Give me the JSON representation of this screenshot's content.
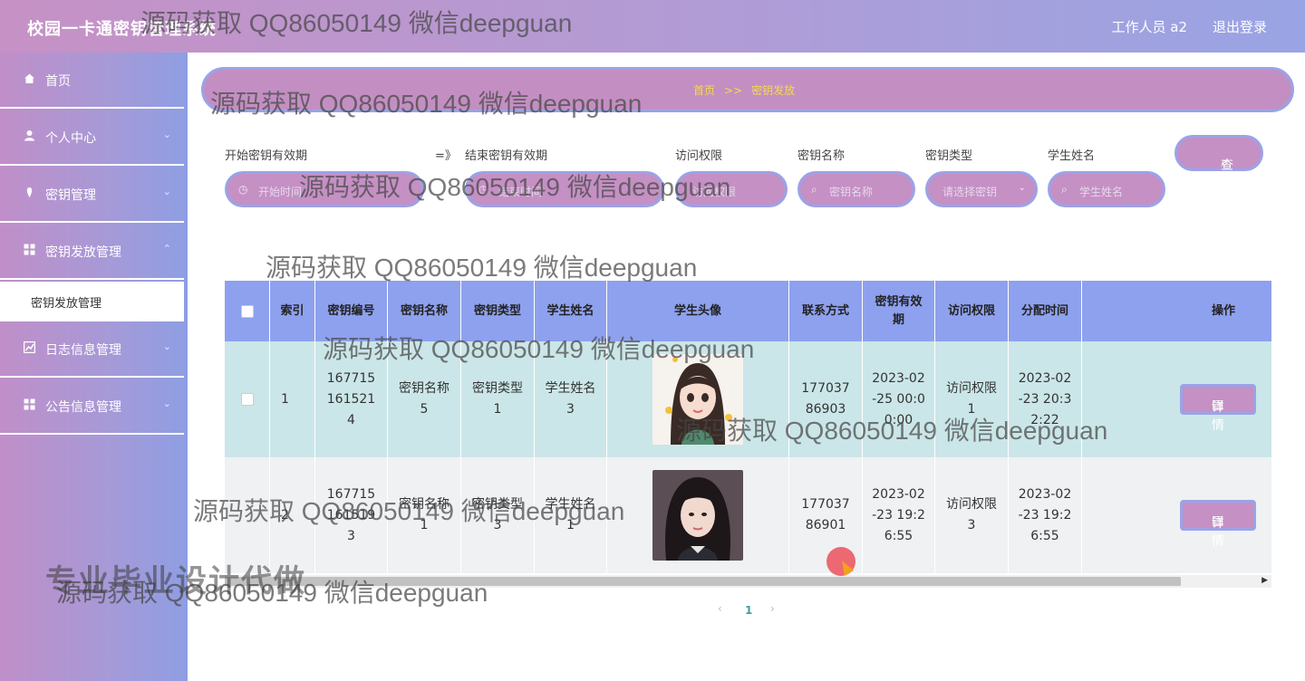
{
  "header": {
    "title": "校园一卡通密钥管理系统",
    "user": "工作人员 a2",
    "logout": "退出登录"
  },
  "sidebar": {
    "items": [
      {
        "label": "首页",
        "icon": "home-icon"
      },
      {
        "label": "个人中心",
        "icon": "user-icon"
      },
      {
        "label": "密钥管理",
        "icon": "key-icon"
      },
      {
        "label": "密钥发放管理",
        "icon": "grid-icon"
      },
      {
        "label": "日志信息管理",
        "icon": "chart-icon"
      },
      {
        "label": "公告信息管理",
        "icon": "grid-icon"
      }
    ],
    "active_sub": "密钥发放管理"
  },
  "breadcrumb": {
    "home": "首页",
    "sep": ">>",
    "current": "密钥发放"
  },
  "search": {
    "start_label": "开始密钥有效期",
    "start_placeholder": "开始时间",
    "arrow": "=》",
    "end_label": "结束密钥有效期",
    "end_placeholder": "结束时间",
    "perm_label": "访问权限",
    "perm_placeholder": "访问权限",
    "keyname_label": "密钥名称",
    "keyname_placeholder": "密钥名称",
    "keytype_label": "密钥类型",
    "keytype_placeholder": "请选择密钥",
    "student_label": "学生姓名",
    "student_placeholder": "学生姓名",
    "button": "查询"
  },
  "table": {
    "columns": [
      "索引",
      "密钥编号",
      "密钥名称",
      "密钥类型",
      "学生姓名",
      "学生头像",
      "联系方式",
      "密钥有效期",
      "访问权限",
      "分配时间",
      "操作"
    ],
    "rows": [
      {
        "index": "1",
        "key_no": "1677151615214",
        "key_name": "密钥名称5",
        "key_type": "密钥类型1",
        "student": "学生姓名3",
        "phone": "17703786903",
        "valid": "2023-02-25 00:00:00",
        "perm": "访问权限1",
        "assigned": "2023-02-23 20:32:22",
        "action": "详情"
      },
      {
        "index": "2",
        "key_no": "1677151615193",
        "key_name": "密钥名称1",
        "key_type": "密钥类型3",
        "student": "学生姓名1",
        "phone": "17703786901",
        "valid": "2023-02-23 19:26:55",
        "perm": "访问权限3",
        "assigned": "2023-02-23 19:26:55",
        "action": "详情"
      }
    ]
  },
  "pagination": {
    "prev": "‹",
    "page": "1",
    "next": "›"
  },
  "watermark": {
    "text": "源码获取 QQ86050149 微信deepguan",
    "big": "专业毕业设计代做"
  }
}
